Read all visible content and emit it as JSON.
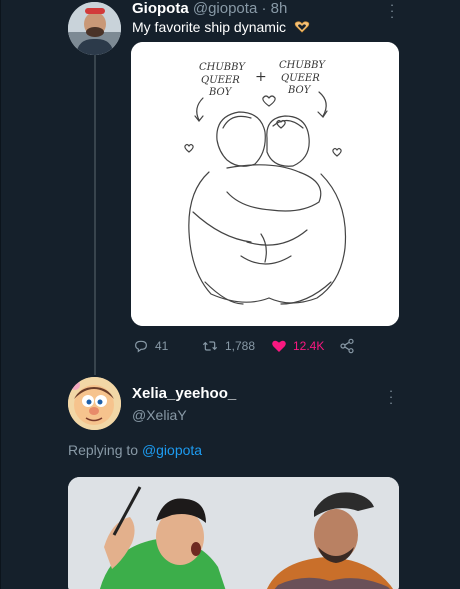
{
  "tweet": {
    "display_name": "Giopota",
    "handle": "@giopota",
    "separator": " · ",
    "time": "8h",
    "text": "My favorite ship dynamic",
    "emoji_icon": "heart-hands-icon",
    "drawing_labels": {
      "left": "CHUBBY QUEER BOY",
      "plus": "+",
      "right": "CHUBBY QUEER BOY"
    },
    "actions": {
      "replies": "41",
      "retweets": "1,788",
      "likes": "12.4K"
    },
    "like_color": "#f91880"
  },
  "reply": {
    "display_name": "Xelia_yeehoo_",
    "handle": "@XeliaY",
    "replying_prefix": "Replying to",
    "replying_to": "@giopota"
  },
  "theme": {
    "background": "#15202b",
    "muted": "#8899a6",
    "link": "#1d9bf0"
  }
}
